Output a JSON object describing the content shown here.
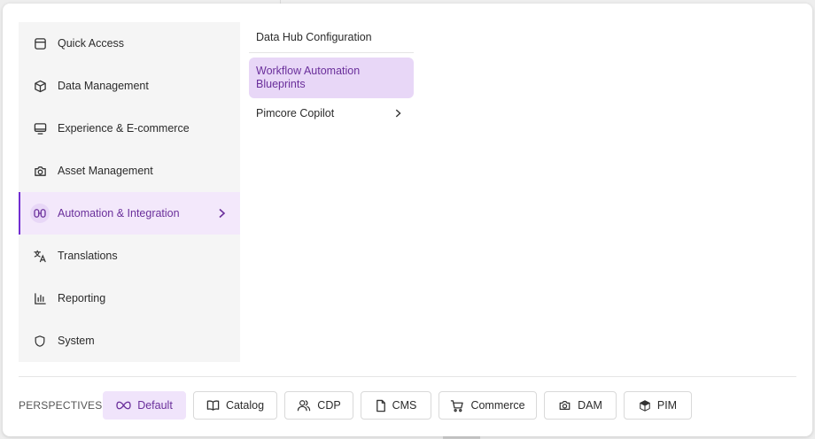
{
  "sidebar": {
    "items": [
      {
        "label": "Quick Access",
        "icon": "quick-access-icon"
      },
      {
        "label": "Data Management",
        "icon": "cube-icon"
      },
      {
        "label": "Experience & E-commerce",
        "icon": "monitor-icon"
      },
      {
        "label": "Asset Management",
        "icon": "camera-icon"
      },
      {
        "label": "Automation & Integration",
        "icon": "automation-icon",
        "active": true
      },
      {
        "label": "Translations",
        "icon": "translate-icon"
      },
      {
        "label": "Reporting",
        "icon": "bar-chart-icon"
      },
      {
        "label": "System",
        "icon": "shield-icon"
      }
    ]
  },
  "submenu": {
    "items": [
      {
        "label": "Data Hub Configuration"
      },
      {
        "label": "Workflow Automation Blueprints",
        "active": true
      },
      {
        "label": "Pimcore Copilot",
        "has_children": true
      }
    ]
  },
  "perspectives": {
    "label": "PERSPECTIVES",
    "buttons": [
      {
        "label": "Default",
        "icon": "infinity-icon",
        "active": true
      },
      {
        "label": "Catalog",
        "icon": "book-icon"
      },
      {
        "label": "CDP",
        "icon": "users-icon"
      },
      {
        "label": "CMS",
        "icon": "file-icon"
      },
      {
        "label": "Commerce",
        "icon": "cart-icon"
      },
      {
        "label": "DAM",
        "icon": "camera-icon"
      },
      {
        "label": "PIM",
        "icon": "cube-icon"
      }
    ]
  },
  "colors": {
    "accent": "#722ed1",
    "active_bg": "#f3e8fb",
    "active_text": "#6a2f9b"
  }
}
